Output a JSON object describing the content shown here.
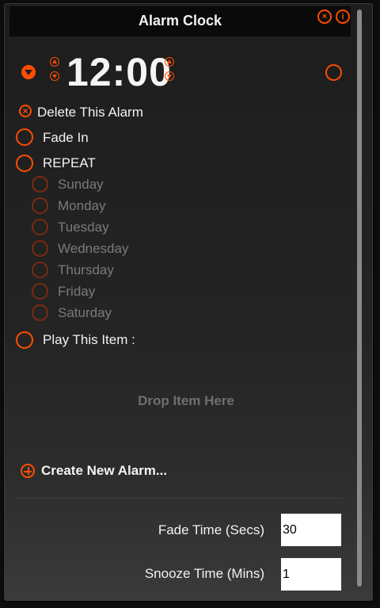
{
  "window": {
    "title": "Alarm Clock"
  },
  "titlebar_icons": [
    {
      "name": "close-icon",
      "glyph": "×"
    },
    {
      "name": "info-icon",
      "glyph": "i"
    }
  ],
  "alarm": {
    "time": "12:00",
    "delete_label": "Delete This Alarm",
    "fade_in_label": "Fade In",
    "repeat_label": "REPEAT",
    "days": [
      "Sunday",
      "Monday",
      "Tuesday",
      "Wednesday",
      "Thursday",
      "Friday",
      "Saturday"
    ],
    "play_label": "Play This Item :",
    "drop_placeholder": "Drop Item Here"
  },
  "create_label": "Create New Alarm...",
  "settings": {
    "fade_label": "Fade Time (Secs)",
    "fade_value": "30",
    "snooze_label": "Snooze Time (Mins)",
    "snooze_value": "1"
  },
  "colors": {
    "accent": "#ff4d00",
    "text": "#f2f2f2",
    "muted": "#7a7a7a"
  }
}
